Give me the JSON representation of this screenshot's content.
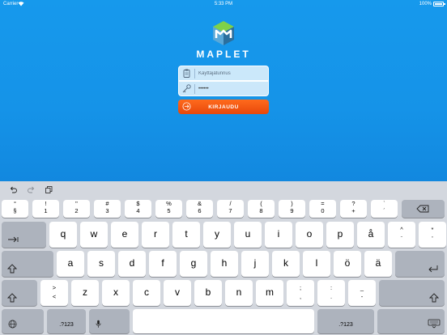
{
  "status_bar": {
    "carrier": "Carrier",
    "time": "5:33 PM",
    "battery": "100%",
    "battery_level": 1.0
  },
  "brand": {
    "name": "MAPLET",
    "logo_icon": "maplet-cube-logo"
  },
  "login": {
    "username_placeholder": "Käyttäjätunnus",
    "username_value": "",
    "password_value": "••••••",
    "button_label": "KIRJAUDU",
    "accent_color": "#f05a16"
  },
  "keyboard": {
    "toolbar": [
      "undo-icon",
      "redo-icon",
      "paste-icon"
    ],
    "row1": [
      {
        "top": "°",
        "bottom": "§"
      },
      {
        "top": "!",
        "bottom": "1"
      },
      {
        "top": "\"",
        "bottom": "2"
      },
      {
        "top": "#",
        "bottom": "3"
      },
      {
        "top": "$",
        "bottom": "4"
      },
      {
        "top": "%",
        "bottom": "5"
      },
      {
        "top": "&",
        "bottom": "6"
      },
      {
        "top": "/",
        "bottom": "7"
      },
      {
        "top": "(",
        "bottom": "8"
      },
      {
        "top": ")",
        "bottom": "9"
      },
      {
        "top": "=",
        "bottom": "0"
      },
      {
        "top": "?",
        "bottom": "+"
      },
      {
        "top": "`",
        "bottom": "´"
      }
    ],
    "row2": [
      "q",
      "w",
      "e",
      "r",
      "t",
      "y",
      "u",
      "i",
      "o",
      "p",
      "å"
    ],
    "row2_extra": [
      {
        "top": "^",
        "bottom": "¨"
      },
      {
        "top": "*",
        "bottom": "'"
      }
    ],
    "row3": [
      "a",
      "s",
      "d",
      "f",
      "g",
      "h",
      "j",
      "k",
      "l",
      "ö",
      "ä"
    ],
    "row4_first": {
      "top": ">",
      "bottom": "<"
    },
    "row4": [
      "z",
      "x",
      "c",
      "v",
      "b",
      "n",
      "m"
    ],
    "row4_punct": [
      {
        "top": ";",
        "bottom": ","
      },
      {
        "top": ":",
        "bottom": "."
      },
      {
        "top": "_",
        "bottom": "-"
      }
    ],
    "numbers_label": ".?123"
  }
}
